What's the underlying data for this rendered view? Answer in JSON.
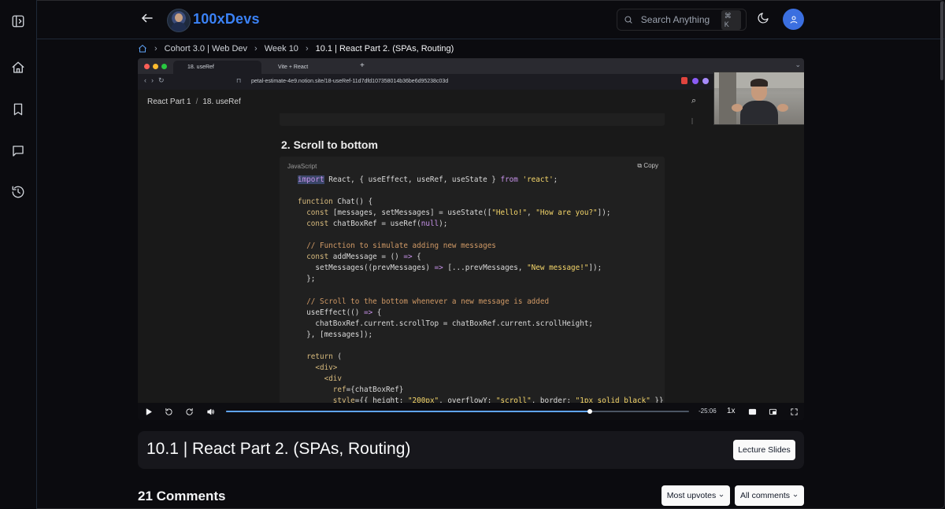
{
  "sidebar": {
    "items": [
      {
        "name": "collapse",
        "icon": "sidebar-toggle-icon"
      },
      {
        "name": "home",
        "icon": "home-icon"
      },
      {
        "name": "bookmarks",
        "icon": "bookmark-icon"
      },
      {
        "name": "questions",
        "icon": "message-square-icon"
      },
      {
        "name": "history",
        "icon": "history-icon"
      }
    ]
  },
  "header": {
    "brand": "100xDevs",
    "search_placeholder": "Search Anything",
    "search_shortcut": "⌘ K",
    "theme_icon": "moon-icon",
    "user_icon": "user-icon",
    "accent": "#3b82f6"
  },
  "breadcrumb": [
    "Cohort 3.0 | Web Dev",
    "Week 10",
    "10.1 | React Part 2. (SPAs, Routing)"
  ],
  "video": {
    "browser": {
      "tab1": "18. useRef",
      "tab2": "Vite + React",
      "url": "petal-estimate-4e9.notion.site/18-useRef-11d7dfd107358014b36be6d95238c03d"
    },
    "notion": {
      "breadcrumb": [
        "React Part 1",
        "18. useRef"
      ],
      "heading": "2. Scroll to bottom",
      "code_language": "JavaScript",
      "copy_label": "Copy"
    },
    "player": {
      "time_remaining": "-25:06",
      "speed": "1x",
      "progress": 0.786
    }
  },
  "lecture": {
    "title": "10.1 | React Part 2. (SPAs, Routing)",
    "slides_button": "Lecture Slides"
  },
  "comments": {
    "count_label": "21 Comments",
    "sort_label": "Most upvotes",
    "filter_label": "All comments"
  }
}
